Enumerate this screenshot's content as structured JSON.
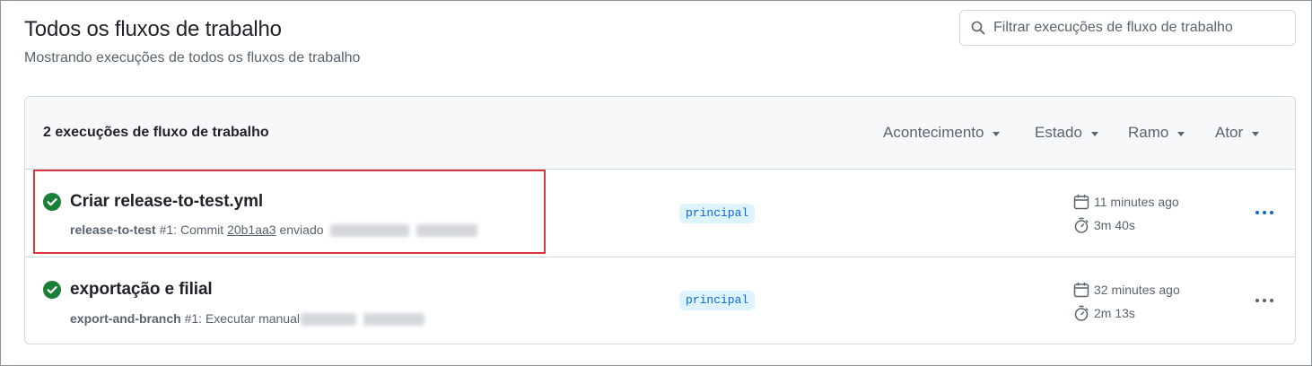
{
  "header": {
    "title": "Todos os fluxos de trabalho",
    "subtitle": "Mostrando execuções de todos os fluxos de trabalho"
  },
  "search": {
    "placeholder": "Filtrar execuções de fluxo de trabalho",
    "icon": "search-icon"
  },
  "list": {
    "count_label": "2 execuções de fluxo de trabalho",
    "filters": [
      "Acontecimento",
      "Estado",
      "Ramo",
      "Ator"
    ]
  },
  "runs": [
    {
      "title": "Criar release-to-test.yml",
      "workflow": "release-to-test",
      "run_number": "#1:",
      "event_text": "Commit",
      "commit": "20b1aa3",
      "event_suffix": "enviado",
      "branch": "principal",
      "time_ago": "11 minutes ago",
      "duration": "3m 40s",
      "status": "success",
      "highlighted": true
    },
    {
      "title": "exportação e filial",
      "workflow": "export-and-branch",
      "run_number": "#1:",
      "event_text": "Executar manual",
      "branch": "principal",
      "time_ago": "32 minutes ago",
      "duration": "2m 13s",
      "status": "success",
      "highlighted": false
    }
  ],
  "colors": {
    "success": "#1a7f37",
    "link": "#0969da",
    "highlight_border": "#d9363e"
  }
}
